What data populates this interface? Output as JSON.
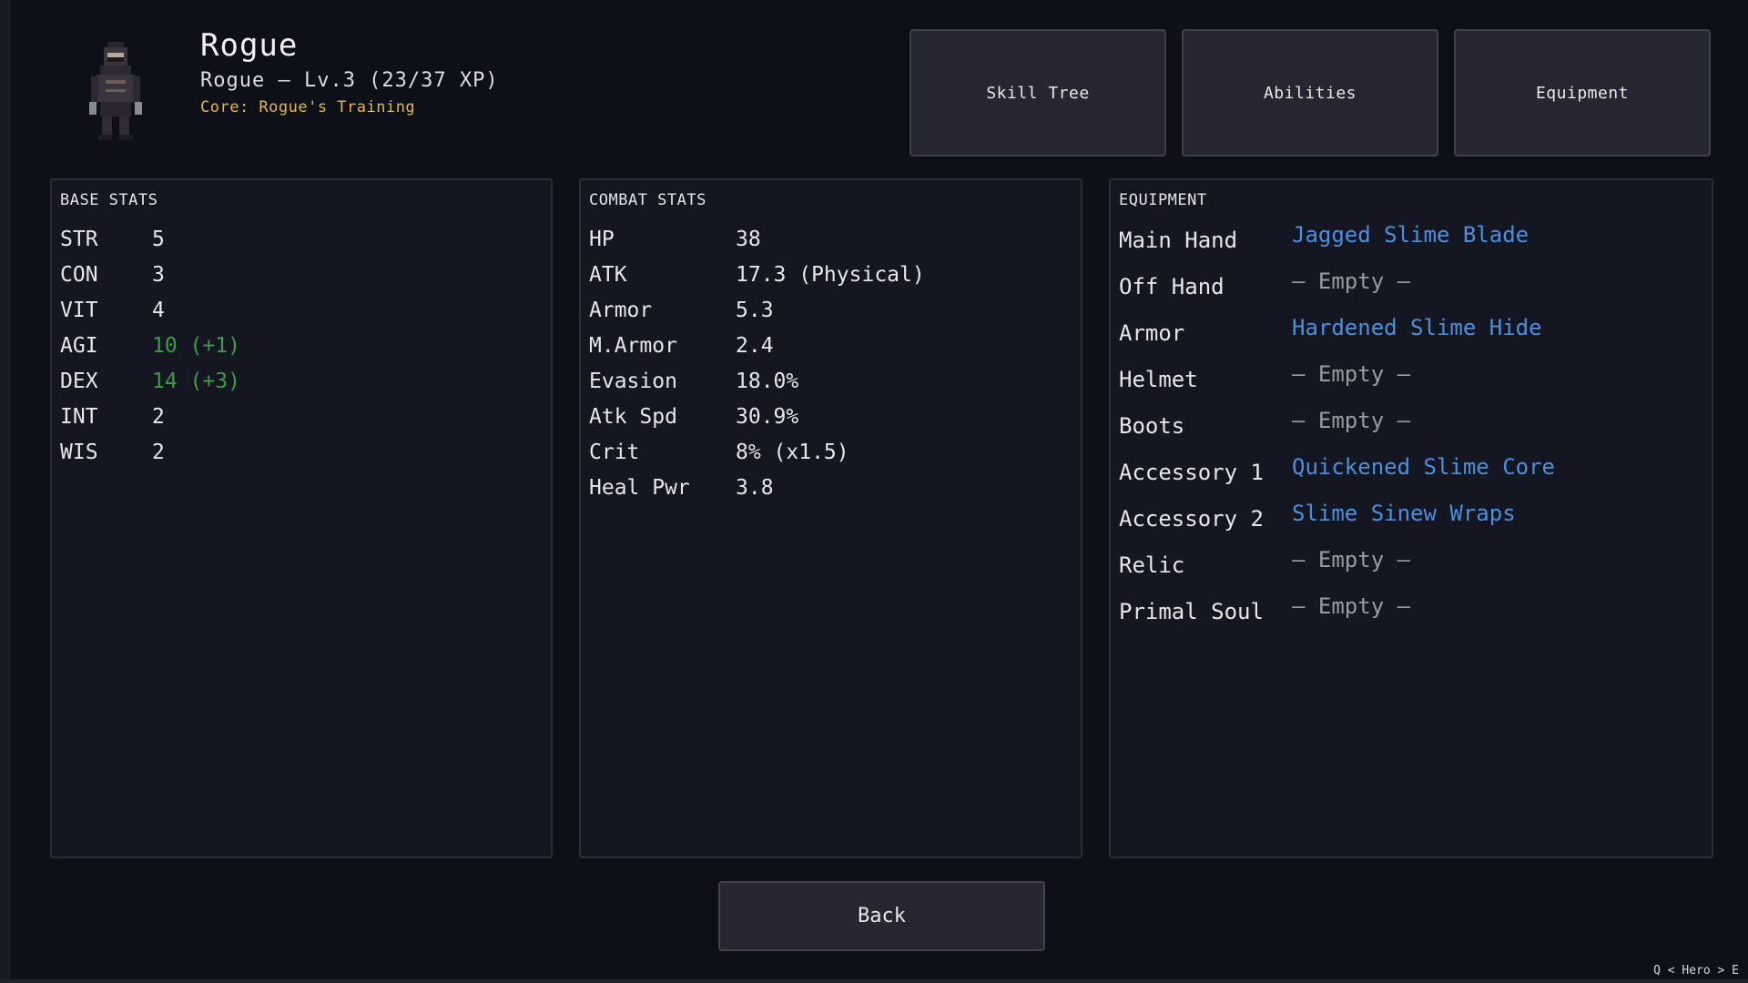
{
  "hero": {
    "name": "Rogue",
    "subtitle": "Rogue – Lv.3 (23/37 XP)",
    "core": "Core: Rogue's Training"
  },
  "nav": {
    "skill_tree": "Skill Tree",
    "abilities": "Abilities",
    "equipment": "Equipment"
  },
  "base_stats": {
    "title": "BASE STATS",
    "rows": [
      {
        "label": "STR",
        "value": "5",
        "buffed": false
      },
      {
        "label": "CON",
        "value": "3",
        "buffed": false
      },
      {
        "label": "VIT",
        "value": "4",
        "buffed": false
      },
      {
        "label": "AGI",
        "value": "10 (+1)",
        "buffed": true
      },
      {
        "label": "DEX",
        "value": "14 (+3)",
        "buffed": true
      },
      {
        "label": "INT",
        "value": "2",
        "buffed": false
      },
      {
        "label": "WIS",
        "value": "2",
        "buffed": false
      }
    ]
  },
  "combat_stats": {
    "title": "COMBAT STATS",
    "rows": [
      {
        "label": "HP",
        "value": "38"
      },
      {
        "label": "ATK",
        "value": "17.3 (Physical)"
      },
      {
        "label": "Armor",
        "value": "5.3"
      },
      {
        "label": "M.Armor",
        "value": "2.4"
      },
      {
        "label": "Evasion",
        "value": "18.0%"
      },
      {
        "label": "Atk Spd",
        "value": "30.9%"
      },
      {
        "label": "Crit",
        "value": "8% (x1.5)"
      },
      {
        "label": "Heal Pwr",
        "value": "3.8"
      }
    ]
  },
  "equipment": {
    "title": "EQUIPMENT",
    "rows": [
      {
        "slot": "Main Hand",
        "item": "Jagged Slime Blade",
        "empty": false
      },
      {
        "slot": "Off Hand",
        "item": "– Empty –",
        "empty": true
      },
      {
        "slot": "Armor",
        "item": "Hardened Slime Hide",
        "empty": false
      },
      {
        "slot": "Helmet",
        "item": "– Empty –",
        "empty": true
      },
      {
        "slot": "Boots",
        "item": "– Empty –",
        "empty": true
      },
      {
        "slot": "Accessory 1",
        "item": "Quickened Slime Core",
        "empty": false
      },
      {
        "slot": "Accessory 2",
        "item": "Slime Sinew Wraps",
        "empty": false
      },
      {
        "slot": "Relic",
        "item": "– Empty –",
        "empty": true
      },
      {
        "slot": "Primal Soul",
        "item": "– Empty –",
        "empty": true
      }
    ]
  },
  "back_label": "Back",
  "nav_hint": "Q < Hero > E",
  "colors": {
    "background": "#0e1019",
    "panel": "#141722",
    "button": "#262633",
    "buff_green": "#3f9a43",
    "item_blue": "#4d8fdc",
    "empty_grey": "#9a9aa3",
    "core_gold": "#e3b93a"
  }
}
